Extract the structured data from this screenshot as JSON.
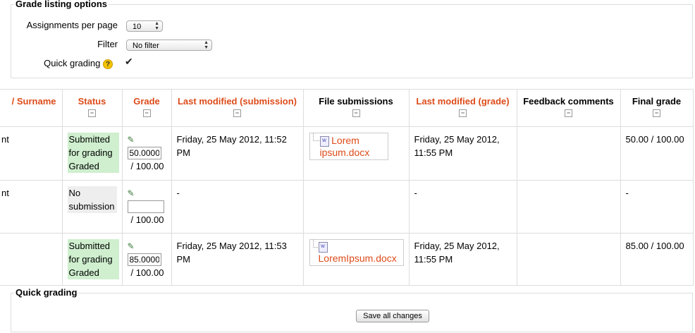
{
  "options": {
    "legend": "Grade listing options",
    "per_page_label": "Assignments per page",
    "per_page_value": "10",
    "filter_label": "Filter",
    "filter_value": "No filter",
    "quick_label": "Quick grading",
    "help_symbol": "?"
  },
  "table": {
    "headers": {
      "surname": "/ Surname",
      "status": "Status",
      "grade": "Grade",
      "modified_sub": "Last modified (submission)",
      "files": "File submissions",
      "modified_grade": "Last modified (grade)",
      "feedback": "Feedback comments",
      "final": "Final grade"
    },
    "collapse_symbol": "−",
    "rows": [
      {
        "name": "nt",
        "status1": "Submitted for grading",
        "status2": "Graded",
        "grade": "50.0000",
        "grade_max": "/ 100.00",
        "modified_sub": "Friday, 25 May 2012, 11:52 PM",
        "file1": "Lorem ipsum.docx",
        "modified_grade": "Friday, 25 May 2012, 11:55 PM",
        "final": "50.00 / 100.00"
      },
      {
        "name": "nt",
        "status1": "No submission",
        "grade": "",
        "grade_max": "/ 100.00",
        "modified_sub": "-",
        "modified_grade": "-",
        "final": "-"
      },
      {
        "name": "",
        "status1": "Submitted for grading",
        "status2": "Graded",
        "grade": "85.0000",
        "grade_max": "/ 100.00",
        "modified_sub": "Friday, 25 May 2012, 11:53 PM",
        "file1": "LoremIpsum.docx",
        "modified_grade": "Friday, 25 May 2012, 11:55 PM",
        "final": "85.00 / 100.00"
      }
    ]
  },
  "quick": {
    "legend": "Quick grading",
    "save_label": "Save all changes"
  },
  "colors": {
    "accent": "#dd4b19",
    "status_green": "#cfefcf"
  },
  "icons": {
    "file": "docx-file-icon",
    "edit": "edit-icon",
    "help": "help-icon"
  }
}
